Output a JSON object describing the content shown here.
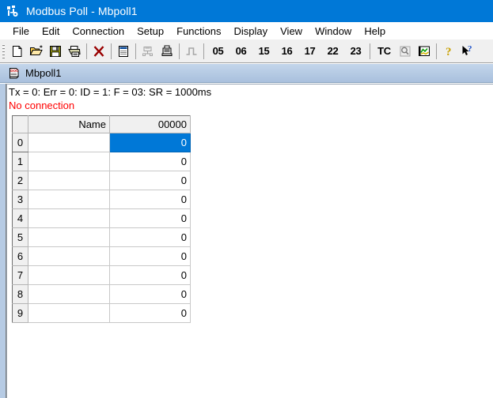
{
  "window": {
    "title": "Modbus Poll - Mbpoll1",
    "app_icon": "modbus-app-icon",
    "titlebar_color": "#0078d7"
  },
  "menu": {
    "items": [
      {
        "label": "File"
      },
      {
        "label": "Edit"
      },
      {
        "label": "Connection"
      },
      {
        "label": "Setup"
      },
      {
        "label": "Functions"
      },
      {
        "label": "Display"
      },
      {
        "label": "View"
      },
      {
        "label": "Window"
      },
      {
        "label": "Help"
      }
    ]
  },
  "toolbar": {
    "buttons": [
      {
        "name": "new-icon",
        "tip": "New"
      },
      {
        "name": "open-icon",
        "tip": "Open"
      },
      {
        "name": "save-icon",
        "tip": "Save"
      },
      {
        "name": "print-icon",
        "tip": "Print"
      },
      {
        "name": "delete-icon",
        "tip": "Delete"
      },
      {
        "name": "read-write-definition-icon",
        "tip": "Read/Write Definition"
      },
      {
        "name": "connect-icon",
        "tip": "Connect"
      },
      {
        "name": "disconnect-icon",
        "tip": "Disconnect"
      },
      {
        "name": "pulse-icon",
        "tip": "Poll"
      }
    ],
    "function_codes": [
      "05",
      "06",
      "15",
      "16",
      "17",
      "22",
      "23"
    ],
    "tc_label": "TC",
    "extra_buttons": [
      {
        "name": "magnifier-icon",
        "tip": "Test Center"
      },
      {
        "name": "chart-icon",
        "tip": "Chart"
      },
      {
        "name": "help-icon",
        "tip": "Help"
      },
      {
        "name": "context-help-icon",
        "tip": "Context Help"
      }
    ]
  },
  "child_window": {
    "title": "Mbpoll1",
    "icon": "document-icon",
    "status_line": "Tx = 0: Err = 0: ID = 1: F = 03: SR = 1000ms",
    "connection_status": "No connection",
    "connection_status_color": "#ff0000"
  },
  "grid": {
    "headers": [
      "",
      "Name",
      "00000"
    ],
    "selected_row": 0,
    "selected_column": 2,
    "selection_color": "#0078d7",
    "rows": [
      {
        "index": "0",
        "name": "",
        "value": "0"
      },
      {
        "index": "1",
        "name": "",
        "value": "0"
      },
      {
        "index": "2",
        "name": "",
        "value": "0"
      },
      {
        "index": "3",
        "name": "",
        "value": "0"
      },
      {
        "index": "4",
        "name": "",
        "value": "0"
      },
      {
        "index": "5",
        "name": "",
        "value": "0"
      },
      {
        "index": "6",
        "name": "",
        "value": "0"
      },
      {
        "index": "7",
        "name": "",
        "value": "0"
      },
      {
        "index": "8",
        "name": "",
        "value": "0"
      },
      {
        "index": "9",
        "name": "",
        "value": "0"
      }
    ]
  }
}
